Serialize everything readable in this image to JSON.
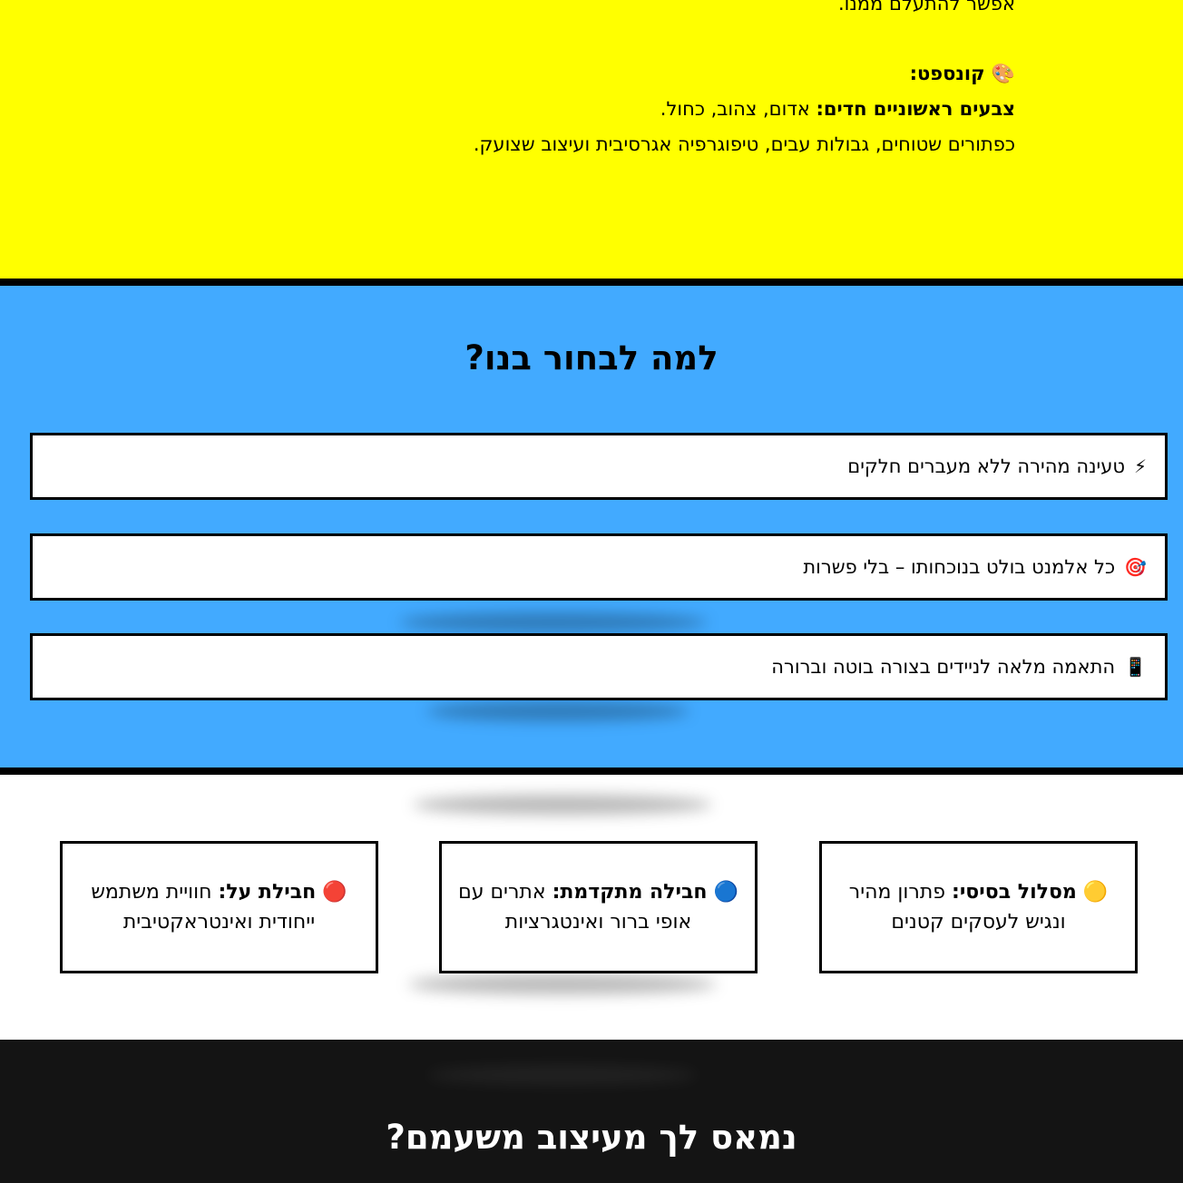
{
  "intro": {
    "cut_line": "אפשר להתעלם ממנו.",
    "concept_icon": "palette-emoji",
    "concept_heading": "קונספט:",
    "concept_line1_bold": "צבעים ראשוניים חדים:",
    "concept_line1_rest": " אדום, צהוב, כחול.",
    "concept_line2": "כפתורים שטוחים, גבולות עבים, טיפוגרפיה אגרסיבית ועיצוב שצועק."
  },
  "why": {
    "title": "למה לבחור בנו?",
    "features": [
      {
        "icon": "lightning-emoji",
        "glyph": "⚡",
        "text": "טעינה מהירה ללא מעברים חלקים"
      },
      {
        "icon": "target-emoji",
        "glyph": "🎯",
        "text": "כל אלמנט בולט בנוכחותו – בלי פשרות"
      },
      {
        "icon": "phone-emoji",
        "glyph": "📱",
        "text": "התאמה מלאה לניידים בצורה בוטה וברורה"
      }
    ]
  },
  "packages": [
    {
      "icon": "yellow-circle-emoji",
      "glyph": "🟡",
      "name": "מסלול בסיסי:",
      "desc": " פתרון מהיר ונגיש לעסקים קטנים"
    },
    {
      "icon": "blue-circle-emoji",
      "glyph": "🔵",
      "name": "חבילה מתקדמת:",
      "desc": " אתרים עם אופי ברור ואינטגרציות"
    },
    {
      "icon": "red-circle-emoji",
      "glyph": "🔴",
      "name": "חבילת על:",
      "desc": " חוויית משתמש ייחודית ואינטראקטיבית"
    }
  ],
  "cta": {
    "title": "נמאס לך מעיצוב משעמם?"
  },
  "colors": {
    "yellow": "#ffff00",
    "blue": "#42aaff",
    "dark": "#141414",
    "border": "#000000"
  }
}
